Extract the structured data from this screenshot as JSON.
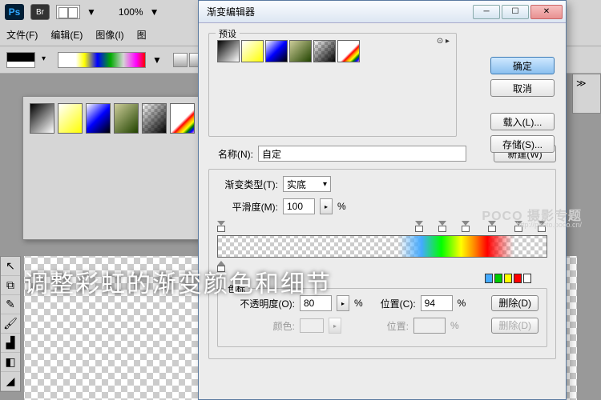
{
  "app": {
    "ps": "Ps",
    "br": "Br",
    "zoom": "100%",
    "dropdown_arrow": "▼"
  },
  "menu": {
    "file": "文件(F)",
    "edit": "编辑(E)",
    "image": "图像(I)",
    "image2": "图"
  },
  "dialog": {
    "title": "渐变编辑器",
    "presets_label": "预设",
    "preset_opts": "⊙ ▸",
    "ok": "确定",
    "cancel": "取消",
    "load": "载入(L)...",
    "save": "存储(S)...",
    "name_label": "名称(N):",
    "name_value": "自定",
    "new": "新建(W)",
    "type_label": "渐变类型(T):",
    "type_value": "实底",
    "smooth_label": "平滑度(M):",
    "smooth_value": "100",
    "pct": "%",
    "stops_label": "色标",
    "opacity_label": "不透明度(O):",
    "opacity_value": "80",
    "pos_label": "位置(C):",
    "pos_value": "94",
    "pos_label2": "位置:",
    "color_label": "颜色:",
    "delete": "删除(D)"
  },
  "caption": "调整彩虹的渐变颜色和细节",
  "watermark": {
    "main": "POCO 摄影专题",
    "sub": "http://photo.poco.cn/"
  },
  "panel_icon": "≫"
}
